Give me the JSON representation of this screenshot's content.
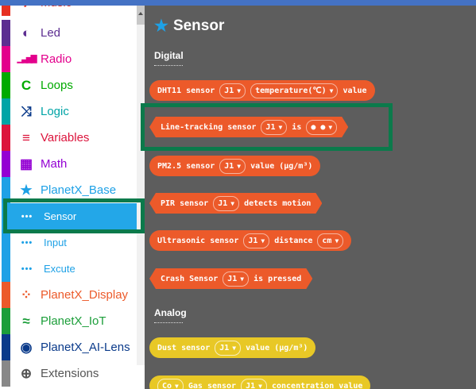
{
  "sidebar": {
    "items": [
      {
        "label": "Music",
        "icon": "headphones-icon",
        "glyph": "♪",
        "color": "#e63022"
      },
      {
        "label": "Led",
        "icon": "toggle-icon",
        "glyph": "◐",
        "color": "#5c2d91"
      },
      {
        "label": "Radio",
        "icon": "signal-bars-icon",
        "glyph": "▁▃▅▇",
        "color": "#e3008c"
      },
      {
        "label": "Loops",
        "icon": "refresh-icon",
        "glyph": "C",
        "color": "#00aa00"
      },
      {
        "label": "Logic",
        "icon": "shuffle-icon",
        "glyph": "⤨",
        "color": "#00a4a6"
      },
      {
        "label": "Variables",
        "icon": "list-icon",
        "glyph": "≡",
        "color": "#dc143c"
      },
      {
        "label": "Math",
        "icon": "calculator-icon",
        "glyph": "▦",
        "color": "#9400d3"
      },
      {
        "label": "PlanetX_Base",
        "icon": "star-icon",
        "glyph": "★",
        "color": "#1ea1e6"
      },
      {
        "label": "Sensor",
        "icon": "dots-icon",
        "glyph": "•••",
        "color": "#ffffff"
      },
      {
        "label": "Input",
        "icon": "dots-icon",
        "glyph": "•••",
        "color": "#1ea1e6"
      },
      {
        "label": "Excute",
        "icon": "dots-icon",
        "glyph": "•••",
        "color": "#1ea1e6"
      },
      {
        "label": "PlanetX_Display",
        "icon": "spinner-icon",
        "glyph": "⁘",
        "color": "#ec5a2a"
      },
      {
        "label": "PlanetX_IoT",
        "icon": "wifi-icon",
        "glyph": "≈",
        "color": "#1c9e3a"
      },
      {
        "label": "PlanetX_AI-Lens",
        "icon": "eye-icon",
        "glyph": "◉",
        "color": "#0a3a8a"
      },
      {
        "label": "Extensions",
        "icon": "plus-circle-icon",
        "glyph": "⊕",
        "color": "#555555"
      }
    ]
  },
  "flyout": {
    "title": "Sensor",
    "title_icon": "star-icon",
    "title_glyph": "★",
    "groups": [
      "Digital",
      "Analog"
    ],
    "blocks": [
      {
        "parts": [
          "DHT11 sensor",
          "J1",
          "temperature(℃)",
          "value"
        ]
      },
      {
        "parts": [
          "Line-tracking sensor",
          "J1",
          "is",
          "● ●"
        ]
      },
      {
        "parts": [
          "PM2.5 sensor",
          "J1",
          "value (μg/m³)"
        ]
      },
      {
        "parts": [
          "PIR sensor",
          "J1",
          "detects motion"
        ]
      },
      {
        "parts": [
          "Ultrasonic sensor",
          "J1",
          "distance",
          "cm"
        ]
      },
      {
        "parts": [
          "Crash Sensor",
          "J1",
          "is pressed"
        ]
      },
      {
        "parts": [
          "Dust sensor",
          "J1",
          "value (μg/m³)"
        ]
      },
      {
        "parts": [
          "Co",
          "Gas sensor",
          "J1",
          "concentration value"
        ]
      }
    ],
    "dropdown_arrow": "▼"
  },
  "colors": {
    "sensor_block": "#ec5a2a",
    "analog_block": "#e8c826",
    "selected_category": "#23a7e8",
    "highlight_box": "#0b7a4b",
    "flyout_background": "#5d5d5d"
  }
}
